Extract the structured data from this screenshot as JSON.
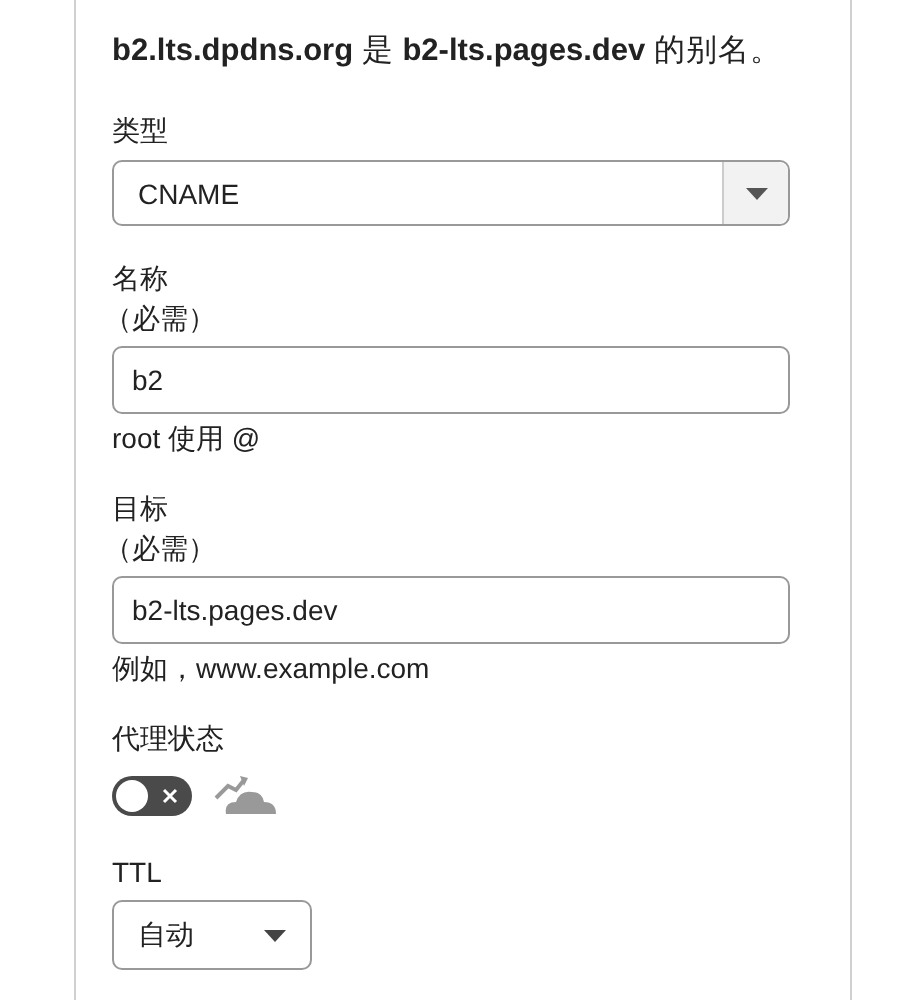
{
  "heading": "**b2.lts.dpdns.org** 是 **b2-lts.pages.dev** 的别名。",
  "type_field": {
    "label": "类型",
    "value": "CNAME"
  },
  "name_field": {
    "label": "名称",
    "required": "（必需）",
    "value": "b2",
    "hint": "root 使用 @"
  },
  "target_field": {
    "label": "目标",
    "required": "（必需）",
    "value": "b2-lts.pages.dev",
    "hint": "例如，www.example.com"
  },
  "proxy": {
    "label": "代理状态",
    "on": false
  },
  "ttl_field": {
    "label": "TTL",
    "value": "自动"
  }
}
